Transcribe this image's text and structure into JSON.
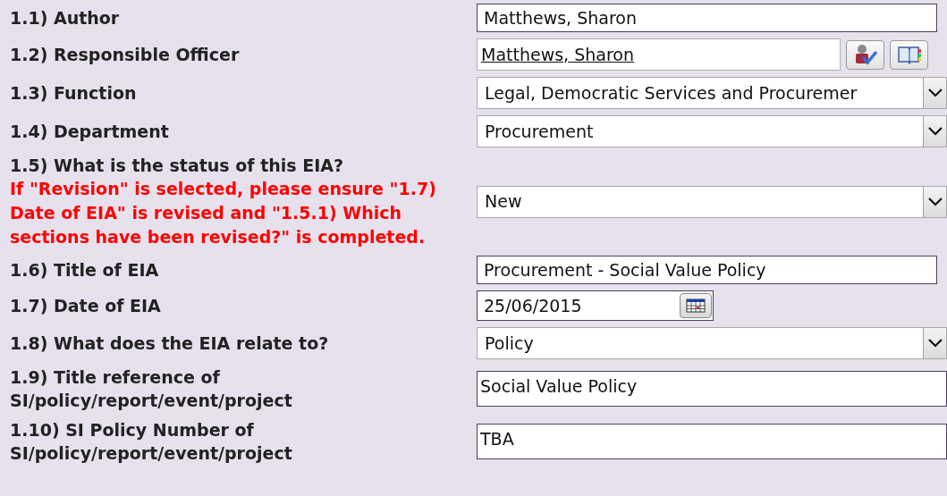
{
  "fields": [
    {
      "label": "1.1) Author",
      "kind": "text",
      "value": "Matthews, Sharon"
    },
    {
      "label": "1.2) Responsible Officer",
      "kind": "person",
      "value": "Matthews, Sharon"
    },
    {
      "label": "1.3) Function",
      "kind": "select",
      "value": "Legal, Democratic Services and Procuremer"
    },
    {
      "label": "1.4) Department",
      "kind": "select",
      "value": "Procurement"
    },
    {
      "label": "1.5) What is the status of this EIA?",
      "note": "If \"Revision\" is selected, please ensure  \"1.7) Date of EIA\" is revised and \"1.5.1) Which sections have been revised?\" is completed.",
      "kind": "select",
      "value": "New"
    },
    {
      "label": "1.6) Title of EIA",
      "kind": "text",
      "value": "Procurement - Social Value Policy"
    },
    {
      "label": "1.7) Date of EIA",
      "kind": "date",
      "value": "25/06/2015"
    },
    {
      "label": "1.8) What does the EIA relate to?",
      "kind": "select",
      "value": "Policy"
    },
    {
      "label": "1.9) Title reference of SI/policy/report/event/project",
      "kind": "textarea",
      "value": "Social Value Policy"
    },
    {
      "label": "1.10) SI Policy Number of SI/policy/report/event/project",
      "kind": "textarea",
      "value": "TBA"
    }
  ]
}
